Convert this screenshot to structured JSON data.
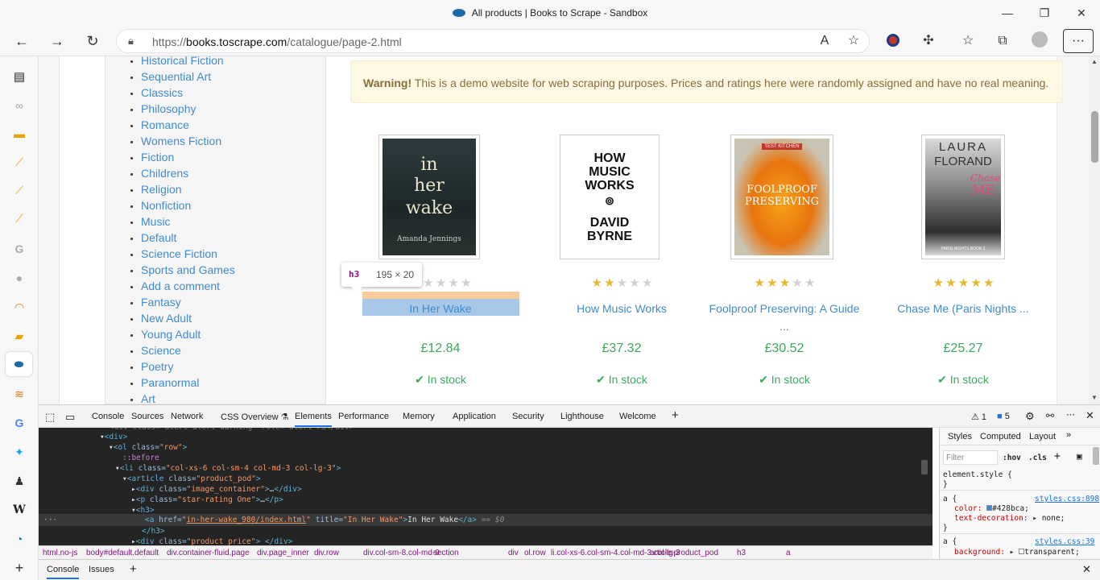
{
  "window": {
    "title": "All products | Books to Scrape - Sandbox"
  },
  "address_bar": {
    "url_prefix": "https://",
    "url_domain": "books.toscrape.com",
    "url_path": "/catalogue/page-2.html"
  },
  "categories": [
    "Historical Fiction",
    "Sequential Art",
    "Classics",
    "Philosophy",
    "Romance",
    "Womens Fiction",
    "Fiction",
    "Childrens",
    "Religion",
    "Nonfiction",
    "Music",
    "Default",
    "Science Fiction",
    "Sports and Games",
    "Add a comment",
    "Fantasy",
    "New Adult",
    "Young Adult",
    "Science",
    "Poetry",
    "Paranormal",
    "Art"
  ],
  "warning": {
    "strong": "Warning!",
    "text": " This is a demo website for web scraping purposes. Prices and ratings here were randomly assigned and have no real meaning."
  },
  "books": [
    {
      "title": "In Her Wake",
      "price": "£12.84",
      "stock": "In stock",
      "rating": 1,
      "cover": {
        "line1": "in",
        "line2": "her",
        "line3": "wake",
        "author": "Amanda Jennings"
      }
    },
    {
      "title": "How Music Works",
      "price": "£37.32",
      "stock": "In stock",
      "rating": 2,
      "cover": {
        "line1": "HOW",
        "line2": "MUSIC",
        "line3": "WORKS",
        "author1": "DAVID",
        "author2": "BYRNE"
      }
    },
    {
      "title": "Foolproof Preserving: A Guide",
      "title_more": "...",
      "price": "£30.52",
      "stock": "In stock",
      "rating": 3,
      "cover": {
        "badge": "TEST KITCHEN",
        "line1": "FOOLPROOF",
        "line2": "PRESERVING"
      }
    },
    {
      "title": "Chase Me (Paris Nights ...",
      "price": "£25.27",
      "stock": "In stock",
      "rating": 5,
      "cover": {
        "author1": "LAURA",
        "author2": "FLORAND",
        "line1": "Chase",
        "line2": "ME",
        "series": "PARIS NIGHTS BOOK 2"
      }
    }
  ],
  "inspect_tooltip": {
    "tag": "h3",
    "size": "195 × 20"
  },
  "devtools": {
    "tabs": [
      "Console",
      "Sources",
      "Network",
      "CSS Overview",
      "Elements",
      "Performance",
      "Memory",
      "Application",
      "Security",
      "Lighthouse",
      "Welcome"
    ],
    "badges": {
      "warnings": "1",
      "issues": "5"
    },
    "breadcrumbs": [
      "html.no-js",
      "body#default.default",
      "div.container-fluid.page",
      "div.page_inner",
      "div.row",
      "div.col-sm-8.col-md-9",
      "section",
      "div",
      "ol.row",
      "li.col-xs-6.col-sm-4.col-md-3.col-lg-3",
      "article.product_pod",
      "h3",
      "a"
    ],
    "styles_tabs": [
      "Styles",
      "Computed",
      "Layout"
    ],
    "filter_placeholder": "Filter",
    "hov": ":hov",
    "cls": ".cls",
    "drawer_tabs": [
      "Console",
      "Issues"
    ],
    "dom_link": "in-her-wake_980/index.html",
    "dom_title": "In Her Wake",
    "dom_text": "In Her Wake",
    "dom_eq": "== $0",
    "rule1": {
      "source": "styles.css:898",
      "selector": "a {",
      "p1": "color:",
      "v1": "#428bca;",
      "p2": "text-decoration:",
      "v2": "none;"
    },
    "rule2": {
      "source": "styles.css:39",
      "selector": "a {",
      "p1": "background:",
      "v1": "transparent;"
    },
    "element_style": "element.style {"
  },
  "colors": {
    "link": "#428bca",
    "price": "#3ea85f",
    "star": "#e6b82f"
  }
}
